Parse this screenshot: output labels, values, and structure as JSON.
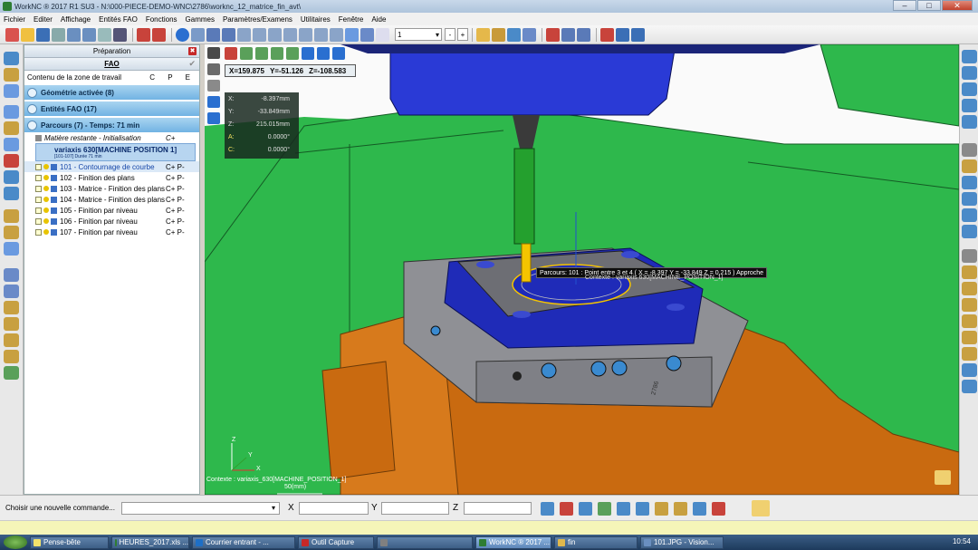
{
  "window": {
    "title": "WorkNC ® 2017 R1 SU3 - N:\\000-PIECE-DEMO-WNC\\2786\\worknc_12_matrice_fin_avt\\",
    "min_label": "–",
    "max_label": "□",
    "close_label": "✕"
  },
  "menu": [
    "Fichier",
    "Editer",
    "Affichage",
    "Entités FAO",
    "Fonctions",
    "Gammes",
    "Paramètres/Examens",
    "Utilitaires",
    "Fenêtre",
    "Aide"
  ],
  "toolbar": {
    "combo_value": "1",
    "minus_label": "-",
    "plus_label": "+"
  },
  "panel": {
    "tab_preparation": "Préparation",
    "tab_fao": "FAO",
    "close_label": "✖",
    "check_label": "✔",
    "zone_label": "Contenu de la zone de travail",
    "zone_flags": "C P E",
    "sections": {
      "geometrie": "Géométrie activée (8)",
      "entites": "Entités FAO (17)",
      "parcours": "Parcours (7) - Temps: 71 min"
    },
    "matiere": {
      "label": "Matière restante - Initialisation",
      "flags": "C+"
    },
    "machine": {
      "label": "variaxis 630[MACHINE POSITION 1]",
      "sub": "[101-107] Durée 71 min"
    },
    "toolpaths": [
      {
        "label": "101 - Contournage de courbe",
        "flags": "C+  P-"
      },
      {
        "label": "102 - Finition des plans",
        "flags": "C+  P-"
      },
      {
        "label": "103 - Matrice - Finition des plans",
        "flags": "C+  P-"
      },
      {
        "label": "104 - Matrice - Finition des plans",
        "flags": "C+  P-"
      },
      {
        "label": "105 - Finition par niveau",
        "flags": "C+  P-"
      },
      {
        "label": "106 - Finition par niveau",
        "flags": "C+  P-"
      },
      {
        "label": "107 - Finition par niveau",
        "flags": "C+  P-"
      }
    ]
  },
  "viewport": {
    "coords_top": {
      "x": "X=159.875",
      "y": "Y=-51.126",
      "z": "Z=-108.583"
    },
    "coords_panel": [
      {
        "k": "X:",
        "v": "-8.397mm"
      },
      {
        "k": "Y:",
        "v": "-33.849mm"
      },
      {
        "k": "Z:",
        "v": "215.015mm"
      },
      {
        "k": "A:",
        "v": "0.0000°"
      },
      {
        "k": "C:",
        "v": "0.0000°"
      }
    ],
    "tooltip": "Parcours: 101 : Point entre 3 et 4 ( X = -8.397  Y = -33.849  Z = 0.215 ) Approche",
    "overlay_label": "Contexte : variaxis 630[MACHINE_POSITION_1]",
    "context_label": "Contexte : variaxis_630[MACHINE_POSITION_1]",
    "scale_label": "50(mm)",
    "fixture_label": "2786",
    "axes": {
      "x": "X",
      "y": "Y",
      "z": "Z"
    },
    "colors": {
      "machine_green": "#2eb84c",
      "table_orange": "#c96a10",
      "spindle_blue": "#2a3ad6",
      "part_blue": "#1f2bb8",
      "fixture_grey": "#8f9095",
      "tool_yellow": "#f5c400"
    }
  },
  "command": {
    "label": "Choisir une nouvelle commande...",
    "x": "X",
    "y": "Y",
    "z": "Z"
  },
  "taskbar": {
    "items": [
      {
        "label": "Pense-bête",
        "color": "#f3e36b"
      },
      {
        "label": "HEURES_2017.xls ...",
        "color": "#2e7d32"
      },
      {
        "label": "Courrier entrant - ...",
        "color": "#1e6fc6"
      },
      {
        "label": "Outil Capture",
        "color": "#c62828"
      },
      {
        "label": "",
        "color": "#808080"
      },
      {
        "label": "WorkNC ® 2017 ...",
        "color": "#2e7d32"
      },
      {
        "label": "fin",
        "color": "#e0b84c"
      },
      {
        "label": "101.JPG - Vision...",
        "color": "#6a8fc0"
      }
    ],
    "clock": "10:54"
  }
}
